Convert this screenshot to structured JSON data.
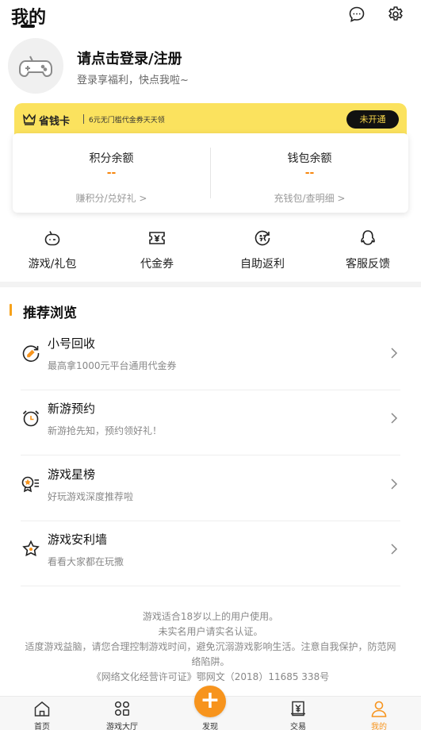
{
  "header": {
    "title": "我的",
    "icons": [
      "message-icon",
      "settings-icon"
    ]
  },
  "profile": {
    "avatar_icon": "gamepad-icon",
    "login_title": "请点击登录/注册",
    "login_subtitle": "登录享福利，快点我啦~"
  },
  "vip": {
    "icon": "crown-icon",
    "name": "省钱卡",
    "description": "6元无门槛代金券天天领",
    "button": "未开通",
    "color": "#fbe25e"
  },
  "balances": [
    {
      "label": "积分余额",
      "value": "--",
      "link": "赚积分/兑好礼 >"
    },
    {
      "label": "钱包余额",
      "value": "--",
      "link": "充钱包/查明细 >"
    }
  ],
  "quick_actions": [
    {
      "label": "游戏/礼包",
      "icon": "gamepad-icon"
    },
    {
      "label": "代金券",
      "icon": "voucher-icon"
    },
    {
      "label": "自助返利",
      "icon": "rebate-icon"
    },
    {
      "label": "客服反馈",
      "icon": "service-icon"
    }
  ],
  "recommend": {
    "title": "推荐浏览",
    "items": [
      {
        "title": "小号回收",
        "subtitle": "最高拿1000元平台通用代金券",
        "icon": "recycle-icon"
      },
      {
        "title": "新游预约",
        "subtitle": "新游抢先知，预约领好礼！",
        "icon": "alarm-clock-icon"
      },
      {
        "title": "游戏星榜",
        "subtitle": "好玩游戏深度推荐啦",
        "icon": "star-list-icon"
      },
      {
        "title": "游戏安利墙",
        "subtitle": "看看大家都在玩撒",
        "icon": "star-badge-icon"
      }
    ]
  },
  "notice": [
    "游戏适合18岁以上的用户使用。",
    "未实名用户请实名认证。",
    "适度游戏益脑，请您合理控制游戏时间，避免沉溺游戏影响生活。注意自我保护，防范网",
    "络陷阱。",
    "《网络文化经营许可证》鄂网文（2018）11685 338号"
  ],
  "tabbar": [
    {
      "label": "首页",
      "icon": "home-icon"
    },
    {
      "label": "游戏大厅",
      "icon": "grid-icon"
    },
    {
      "label": "发现",
      "icon": "plus-icon"
    },
    {
      "label": "交易",
      "icon": "trade-icon"
    },
    {
      "label": "我的",
      "icon": "user-icon",
      "active": true
    }
  ],
  "colors": {
    "accent": "#f7941d",
    "balance_value": "#f7860e",
    "section_marker": "#f7a21b"
  }
}
